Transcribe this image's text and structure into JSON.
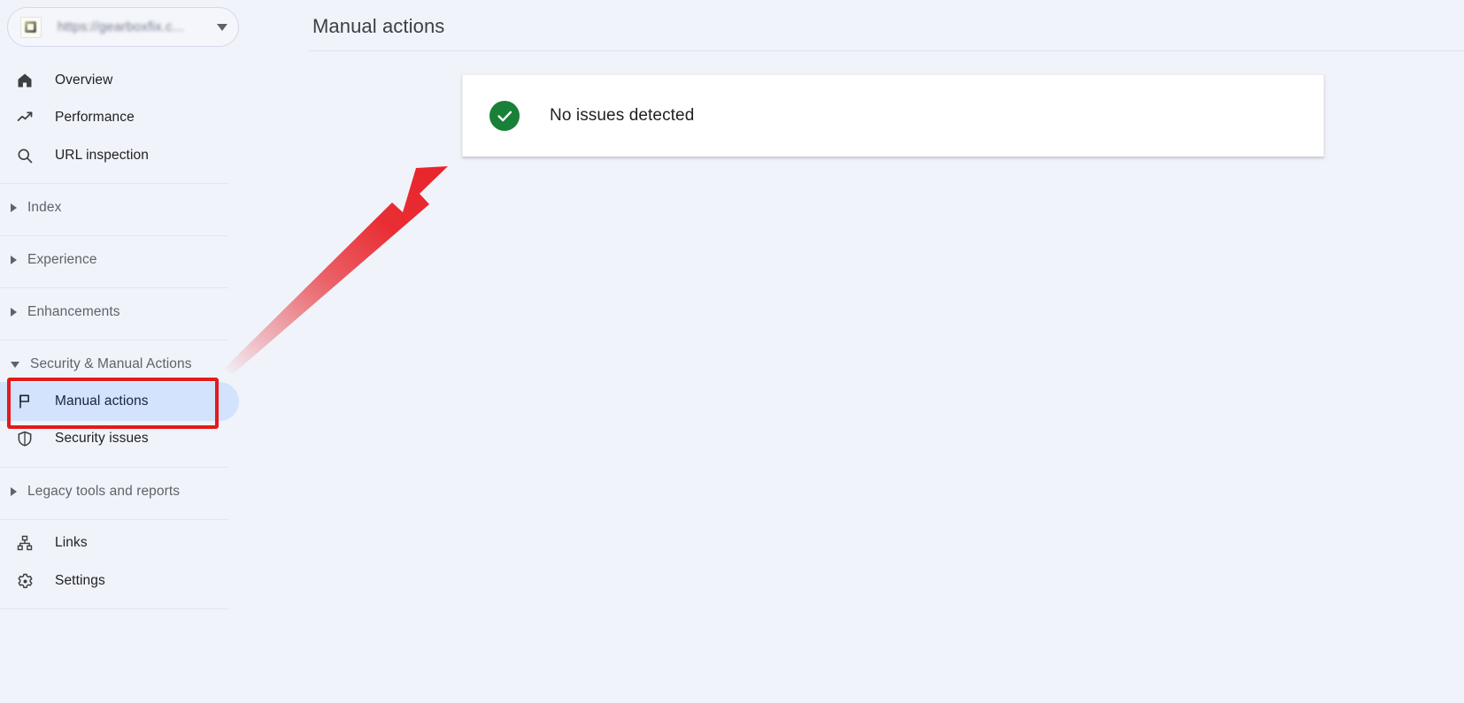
{
  "app": {
    "background_color": "#f1f3fb",
    "accent_color": "#d3e2fd",
    "annotation_color": "#e21b1b",
    "success_color": "#188038"
  },
  "property_selector": {
    "favicon_name": "site-favicon",
    "url": "https://gearboxfix.c...",
    "caret_icon": "chevron-down-icon"
  },
  "sidebar": {
    "primary_items": [
      {
        "label": "Overview",
        "icon": "home-icon"
      },
      {
        "label": "Performance",
        "icon": "trending-up-icon"
      },
      {
        "label": "URL inspection",
        "icon": "search-icon"
      }
    ],
    "sections": [
      {
        "label": "Index",
        "expanded": false,
        "icon": "chevron-right-icon"
      },
      {
        "label": "Experience",
        "expanded": false,
        "icon": "chevron-right-icon"
      },
      {
        "label": "Enhancements",
        "expanded": false,
        "icon": "chevron-right-icon"
      },
      {
        "label": "Security & Manual Actions",
        "expanded": true,
        "icon": "chevron-down-icon"
      }
    ],
    "security_items": [
      {
        "label": "Manual actions",
        "icon": "flag-icon",
        "selected": true
      },
      {
        "label": "Security issues",
        "icon": "shield-icon",
        "selected": false
      }
    ],
    "legacy_section": {
      "label": "Legacy tools and reports",
      "expanded": false,
      "icon": "chevron-right-icon"
    },
    "footer_items": [
      {
        "label": "Links",
        "icon": "sitemap-icon"
      },
      {
        "label": "Settings",
        "icon": "gear-icon"
      }
    ]
  },
  "main": {
    "title": "Manual actions",
    "status": {
      "icon": "check-circle-icon",
      "message": "No issues detected"
    }
  },
  "annotations": {
    "arrow": {
      "icon": "arrow-up-right-icon",
      "color": "#e8242a"
    },
    "highlight": {
      "target_label": "Manual actions",
      "color": "#e21b1b"
    }
  }
}
